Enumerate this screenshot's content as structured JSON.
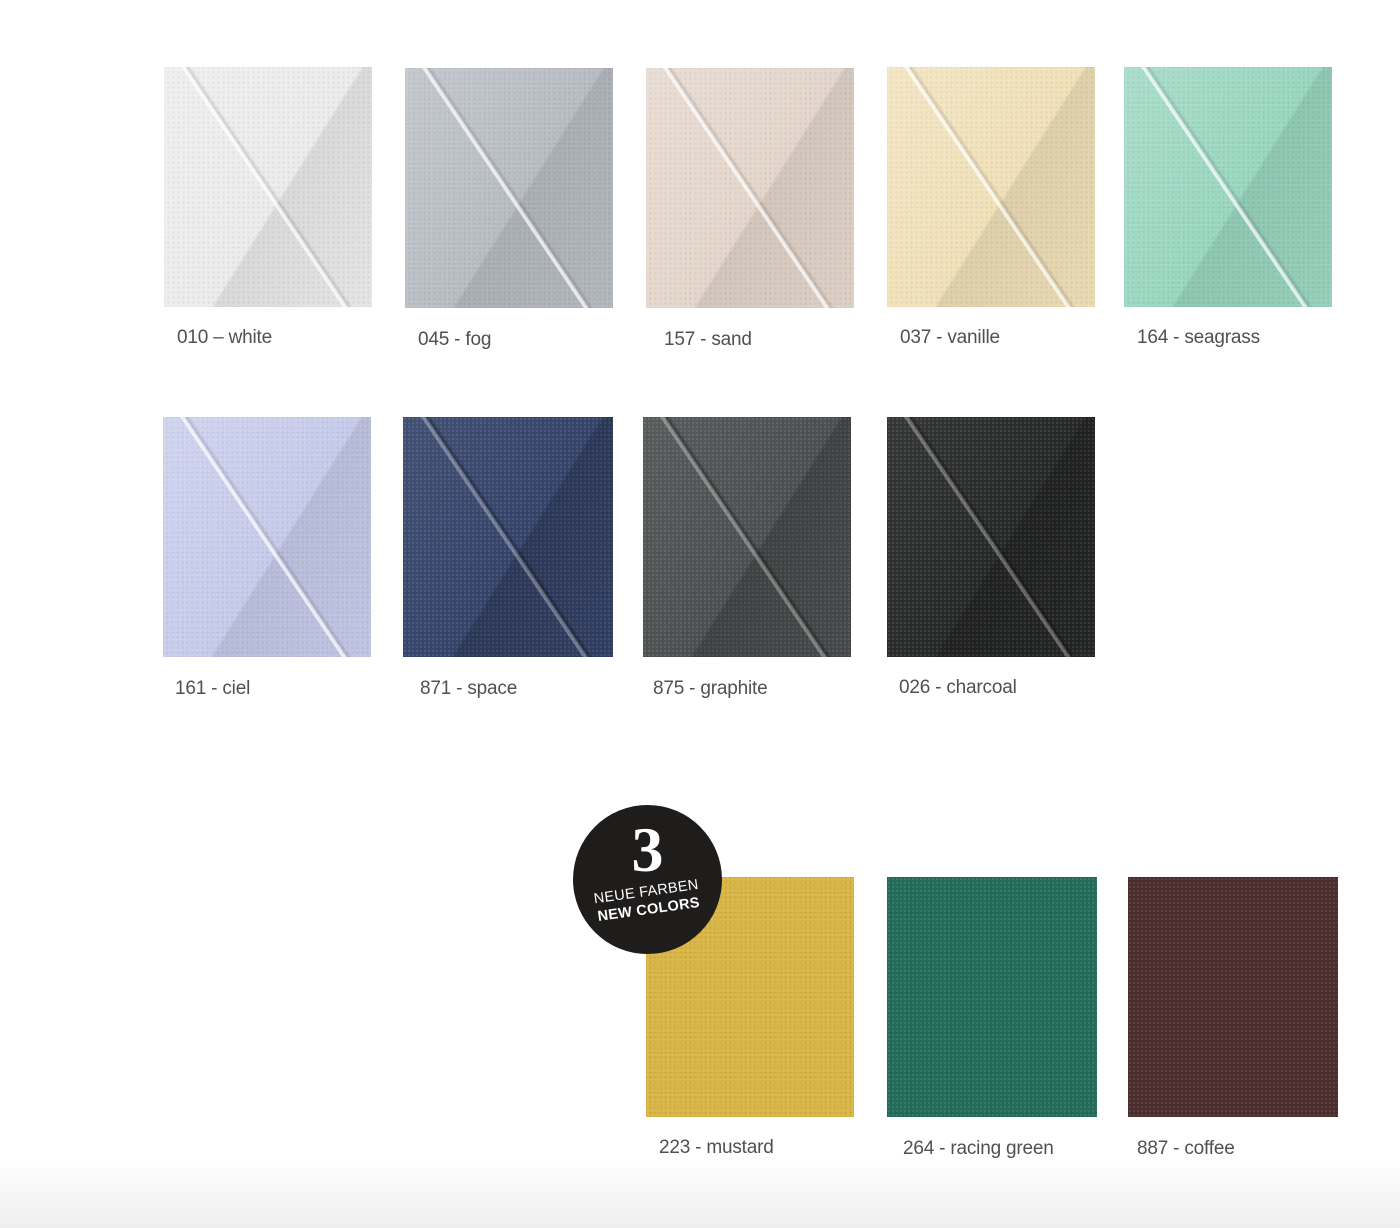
{
  "swatches": [
    {
      "label": "010 – white",
      "color": "#ececec",
      "folded": true,
      "label_color": "#505050"
    },
    {
      "label": "045 - fog",
      "color": "#b7bcc3",
      "folded": true,
      "label_color": "#505050"
    },
    {
      "label": "157 - sand",
      "color": "#e4d6cb",
      "folded": true,
      "label_color": "#505050"
    },
    {
      "label": "037 - vanille",
      "color": "#f1e1b8",
      "folded": true,
      "label_color": "#505050"
    },
    {
      "label": "164 - seagrass",
      "color": "#98d6bf",
      "folded": true,
      "label_color": "#505050"
    },
    {
      "label": "161 - ciel",
      "color": "#c6cbeb",
      "folded": true,
      "label_color": "#505050"
    },
    {
      "label": "871 - space",
      "color": "#34436a",
      "folded": true,
      "label_color": "#505050"
    },
    {
      "label": "875 - graphite",
      "color": "#4c4f50",
      "folded": true,
      "label_color": "#505050"
    },
    {
      "label": "026 - charcoal",
      "color": "#262827",
      "folded": true,
      "label_color": "#505050"
    },
    {
      "label": "223 - mustard",
      "color": "#d8b443",
      "folded": false,
      "label_color": "#505050"
    },
    {
      "label": "264 - racing green",
      "color": "#216b58",
      "folded": false,
      "label_color": "#505050"
    },
    {
      "label": "887 -  coffee",
      "color": "#4b2c2c",
      "folded": false,
      "label_color": "#505050"
    }
  ],
  "badge": {
    "number": "3",
    "line1": "NEUE FARBEN",
    "line2": "NEW COLORS",
    "background": "#1f1d1c"
  }
}
